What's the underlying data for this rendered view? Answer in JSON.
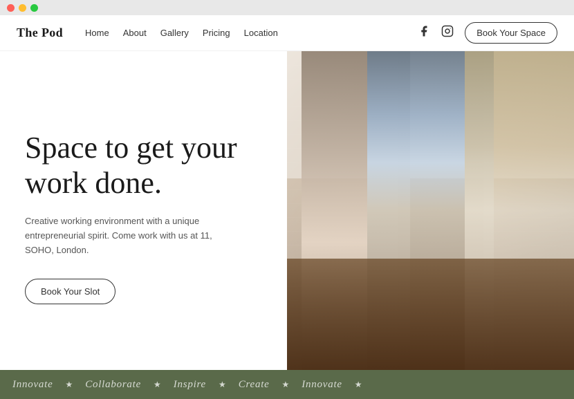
{
  "titleBar": {
    "dots": [
      "red",
      "yellow",
      "green"
    ]
  },
  "navbar": {
    "brand": "The Pod",
    "links": [
      {
        "label": "Home",
        "href": "#"
      },
      {
        "label": "About",
        "href": "#"
      },
      {
        "label": "Gallery",
        "href": "#"
      },
      {
        "label": "Pricing",
        "href": "#"
      },
      {
        "label": "Location",
        "href": "#"
      }
    ],
    "bookButton": "Book Your Space"
  },
  "hero": {
    "headline": "Space to get your work done.",
    "subtext": "Creative working environment with a unique entrepreneurial spirit. Come work with us at 11, SOHO, London.",
    "ctaButton": "Book Your Slot"
  },
  "ticker": {
    "words": [
      "Innovate",
      "Collaborate",
      "Inspire",
      "Create",
      "Innovate"
    ],
    "separator": "★"
  }
}
